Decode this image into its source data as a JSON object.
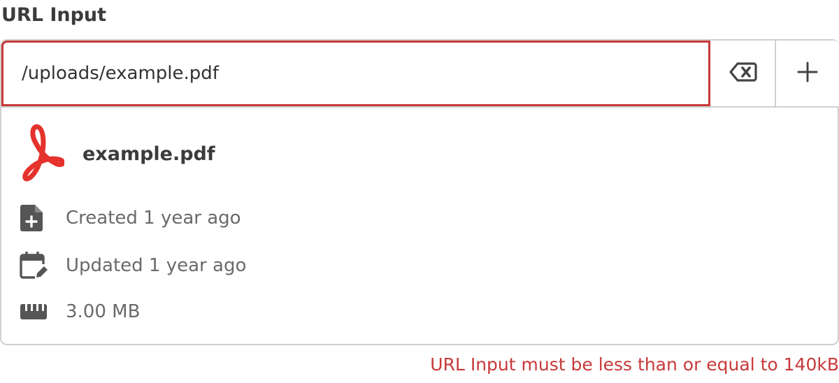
{
  "field": {
    "label": "URL Input",
    "value": "/uploads/example.pdf",
    "placeholder": ""
  },
  "actions": {
    "clear_icon": "backspace-clear-icon",
    "add_icon": "plus-icon"
  },
  "file": {
    "icon": "adobe-acrobat-pdf-icon",
    "name": "example.pdf",
    "created_icon": "file-plus-icon",
    "created": "Created 1 year ago",
    "updated_icon": "calendar-edit-icon",
    "updated": "Updated 1 year ago",
    "size_icon": "memory-chip-icon",
    "size": "3.00 MB"
  },
  "validation": {
    "error": "URL Input must be less than or equal to 140kB"
  },
  "colors": {
    "error": "#c7393a",
    "pdf_brand": "#e5322d",
    "border": "#d0d0d0",
    "icon": "#555555"
  }
}
